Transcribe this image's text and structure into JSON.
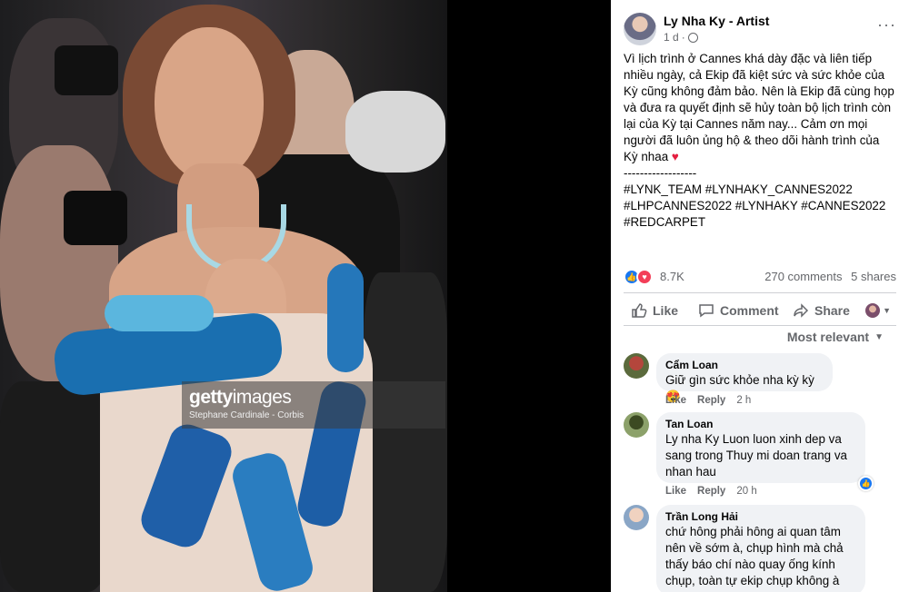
{
  "photo": {
    "watermark_logo_bold": "getty",
    "watermark_logo_thin": "images",
    "watermark_credit": "Stephane Cardinale - Corbis"
  },
  "post": {
    "author": "Ly Nha Ky - Artist",
    "time": "1 d",
    "more_label": "···",
    "text_paragraph": "Vì lịch trình ở Cannes khá dày đặc và liên tiếp nhiều ngày, cả Ekip đã kiệt sức và sức khỏe của Kỳ cũng không đảm bảo. Nên là Ekip đã cùng họp và đưa ra quyết định sẽ hủy toàn bộ lịch trình còn lại của Kỳ tại Cannes năm nay... Cảm ơn mọi người đã luôn ủng hộ & theo dõi hành trình của Kỳ nhaa",
    "heart_emoji": "♥",
    "separator": "------------------",
    "hashtags": "#LYNK_TEAM #LYNHAKY_CANNES2022 #LHPCANNES2022 #LYNHAKY #CANNES2022 #REDCARPET",
    "reaction_count": "8.7K",
    "comments_count": "270 comments",
    "shares_count": "5 shares"
  },
  "actions": {
    "like": "Like",
    "comment": "Comment",
    "share": "Share"
  },
  "sort_label": "Most relevant",
  "comments": [
    {
      "name": "Cẩm Loan",
      "text": "Giữ gìn sức khỏe nha kỳ kỳ 😍",
      "like": "Like",
      "reply": "Reply",
      "time": "2 h"
    },
    {
      "name": "Tan Loan",
      "text": "Ly nha Ky Luon luon xinh dep va sang trong Thuy mi doan trang va nhan hau",
      "like": "Like",
      "reply": "Reply",
      "time": "20 h"
    },
    {
      "name": "Trần Long Hải",
      "text": "chứ hông phải hông ai quan tâm nên về sớm à, chụp hình mà chả thấy báo chí nào quay ống kính chụp, toàn tự ekip chụp không à",
      "like": "",
      "reply": "",
      "time": ""
    }
  ],
  "colors": {
    "accent": "#1877f2",
    "love": "#f33e58",
    "secondary_text": "#65676b",
    "bubble": "#f0f2f5"
  }
}
